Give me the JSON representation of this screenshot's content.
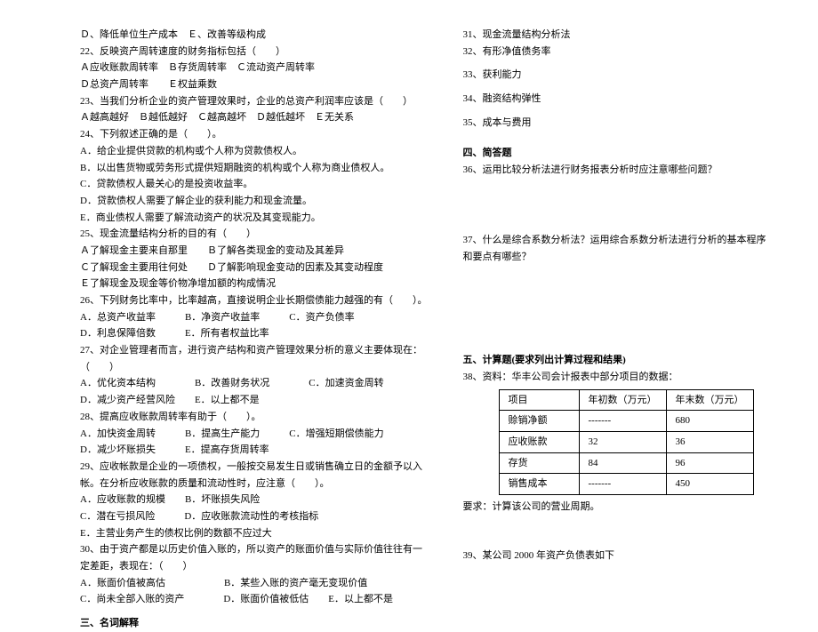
{
  "left": {
    "l21_de": "Ｄ、降低单位生产成本　Ｅ、改善等级构成",
    "q22": "22、反映资产周转速度的财务指标包括（　　）",
    "q22_opts1": "Ａ应收账款周转率　Ｂ存货周转率　Ｃ流动资产周转率",
    "q22_opts2": "Ｄ总资产周转率　　Ｅ权益乘数",
    "q23": "23、当我们分析企业的资产管理效果时，企业的总资产利润率应该是（　　）",
    "q23_opts": "Ａ越高越好　Ｂ越低越好　Ｃ越高越坏　Ｄ越低越坏　Ｅ无关系",
    "q24": "24、下列叙述正确的是（　　）。",
    "q24_a": "A．给企业提供贷款的机构或个人称为贷款债权人。",
    "q24_b": "B．以出售货物或劳务形式提供短期融资的机构或个人称为商业债权人。",
    "q24_c": "C．贷款债权人最关心的是投资收益率。",
    "q24_d": "D．贷款债权人需要了解企业的获利能力和现金流量。",
    "q24_e": "E．商业债权人需要了解流动资产的状况及其变现能力。",
    "q25": "25、现金流量结构分析的目的有（　　）",
    "q25_ab": "Ａ了解现金主要来自那里　　Ｂ了解各类现金的变动及其差异",
    "q25_cd": "Ｃ了解现金主要用往何处　　Ｄ了解影响现金变动的因素及其变动程度",
    "q25_e": "Ｅ了解现金及现金等价物净增加额的构成情况",
    "q26": "26、下列财务比率中，比率越高，直接说明企业长期偿债能力越强的有（　　）。",
    "q26_opts1": "A．总资产收益率　　　B．净资产收益率　　　C．资产负债率",
    "q26_opts2": "D．利息保障倍数　　　E．所有者权益比率",
    "q27": "27、对企业管理者而言，进行资产结构和资产管理效果分析的意义主要体现在：（　　）",
    "q27_opts1": "A．优化资本结构　　　　B．改善财务状况　　　　C．加速资金周转",
    "q27_opts2": "D．减少资产经营风险　　E．以上都不是",
    "q28": "28、提高应收账款周转率有助于（　　）。",
    "q28_opts1": "A．加快资金周转　　　B．提高生产能力　　　C．增强短期偿债能力",
    "q28_opts2": "D．减少坏账损失　　　E．提高存货周转率",
    "q29": "29、应收帐款是企业的一项债权，一般按交易发生日或销售确立日的金额予以入帐。在分析应收账款的质量和流动性时，应注意（　　）。",
    "q29_a_b": "A．应收账款的规模　　B．坏账损失风险",
    "q29_c_d": "C．潜在亏损风险　　　D．应收账款流动性的考核指标",
    "q29_e": "E．主营业务产生的债权比例的数额不应过大",
    "q30": "30、由于资产都是以历史价值入账的，所以资产的账面价值与实际价值往往有一定差距，表现在：（　　）",
    "q30_ab": "A．账面价值被高估　　　　　　B．某些入账的资产毫无变现价值",
    "q30_cde": "C．尚未全部入账的资产　　　　D．账面价值被低估　　E．以上都不是",
    "sec3": "三、名词解释"
  },
  "right": {
    "q31": "31、现金流量结构分析法",
    "q32": "32、有形净值债务率",
    "q33": "33、获利能力",
    "q34": "34、融资结构弹性",
    "q35": "35、成本与费用",
    "sec4": "四、简答题",
    "q36": "36、运用比较分析法进行财务报表分析时应注意哪些问题？",
    "q37": "37、什么是综合系数分析法？运用综合系数分析法进行分析的基本程序和要点有哪些？",
    "sec5": "五、计算题(要求列出计算过程和结果)",
    "q38": "38、资料：华丰公司会计报表中部分项目的数据：",
    "table": {
      "h1": "项目",
      "h2": "年初数（万元）",
      "h3": "年末数（万元）",
      "r1c1": "赊销净额",
      "r1c2": "-------",
      "r1c3": "680",
      "r2c1": "应收账款",
      "r2c2": "32",
      "r2c3": "36",
      "r3c1": "存货",
      "r3c2": "84",
      "r3c3": "96",
      "r4c1": "销售成本",
      "r4c2": "-------",
      "r4c3": "450"
    },
    "q38_req": "要求：计算该公司的营业周期。",
    "q39": "39、某公司 2000 年资产负债表如下"
  }
}
